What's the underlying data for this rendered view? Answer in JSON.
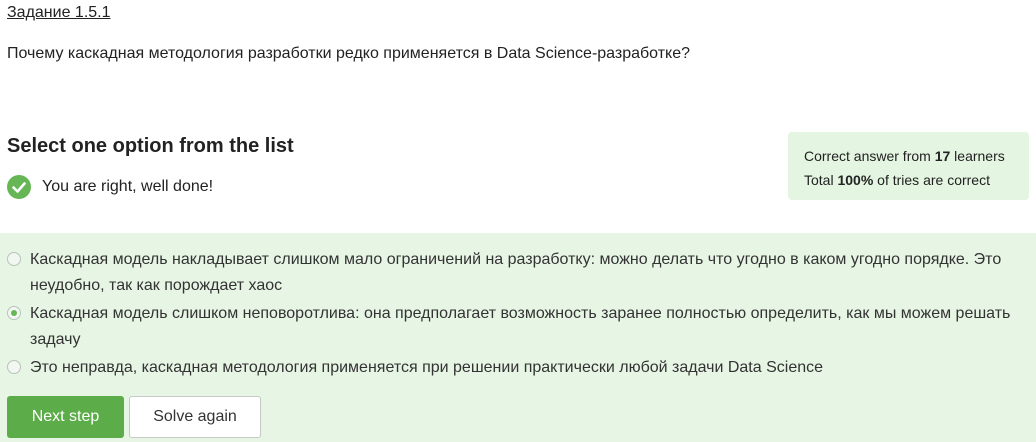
{
  "task": {
    "link_label": "Задание 1.5.1",
    "question": "Почему каскадная методология разработки редко применяется в Data Science-разработке?"
  },
  "quiz": {
    "section_title": "Select one option from the list",
    "result_message": "You are right, well done!",
    "stats": {
      "line1_prefix": "Correct answer from ",
      "learners_count": "17",
      "line1_suffix": " learners",
      "line2_prefix": "Total ",
      "percent": "100%",
      "line2_suffix": " of tries are correct"
    },
    "options": [
      {
        "label": "Каскадная модель накладывает слишком мало ограничений на разработку: можно делать что угодно в каком угодно порядке. Это неудобно, так как порождает хаос",
        "selected": false
      },
      {
        "label": "Каскадная модель слишком неповоротлива: она предполагает возможность заранее полностью определить, как мы можем решать задачу",
        "selected": true
      },
      {
        "label": "Это неправда, каскадная методология применяется при решении практически любой задачи Data Science",
        "selected": false
      }
    ],
    "buttons": {
      "next": "Next step",
      "solve_again": "Solve again"
    }
  },
  "colors": {
    "accent_green": "#5cad4a",
    "panel_green": "#e7f5e5",
    "check_green": "#66b655"
  }
}
